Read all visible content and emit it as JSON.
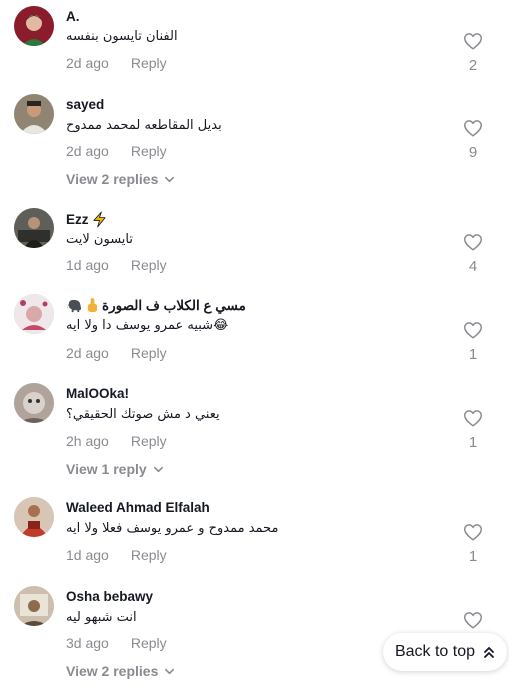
{
  "comments": [
    {
      "username": "A.",
      "text": "الفنان تايسون بنفسه",
      "time": "2d ago",
      "reply": "Reply",
      "likes": "2",
      "avatar_color": "#7a2030"
    },
    {
      "username": "sayed",
      "text": "بديل المقاطعه لمحمد ممدوح",
      "time": "2d ago",
      "reply": "Reply",
      "likes": "9",
      "view_replies": "View 2 replies",
      "avatar_color": "#6b5a48"
    },
    {
      "username": "Ezz",
      "text": "تايسون لايت",
      "time": "1d ago",
      "reply": "Reply",
      "likes": "4",
      "avatar_color": "#3e3f3a"
    },
    {
      "username": "مسي ع الكلاب ف الصورة",
      "text": "شبيه عمرو يوسف دا ولا ايه😂",
      "time": "2d ago",
      "reply": "Reply",
      "likes": "1",
      "avatar_color": "#d8c4c8"
    },
    {
      "username": "MalOOka!",
      "text": "يعني د مش صوتك الحقيقي؟",
      "time": "2h ago",
      "reply": "Reply",
      "likes": "1",
      "view_replies": "View 1 reply",
      "avatar_color": "#9a8a86"
    },
    {
      "username": "Waleed Ahmad Elfalah",
      "text": "محمد ممدوح و عمرو يوسف فعلا ولا ايه",
      "time": "1d ago",
      "reply": "Reply",
      "likes": "1",
      "avatar_color": "#b83b2f"
    },
    {
      "username": "Osha bebawy",
      "text": "انت شبهو ليه",
      "time": "3d ago",
      "reply": "Reply",
      "likes": "",
      "view_replies": "View 2 replies",
      "avatar_color": "#a8927a"
    }
  ],
  "back_to_top": "Back to top"
}
